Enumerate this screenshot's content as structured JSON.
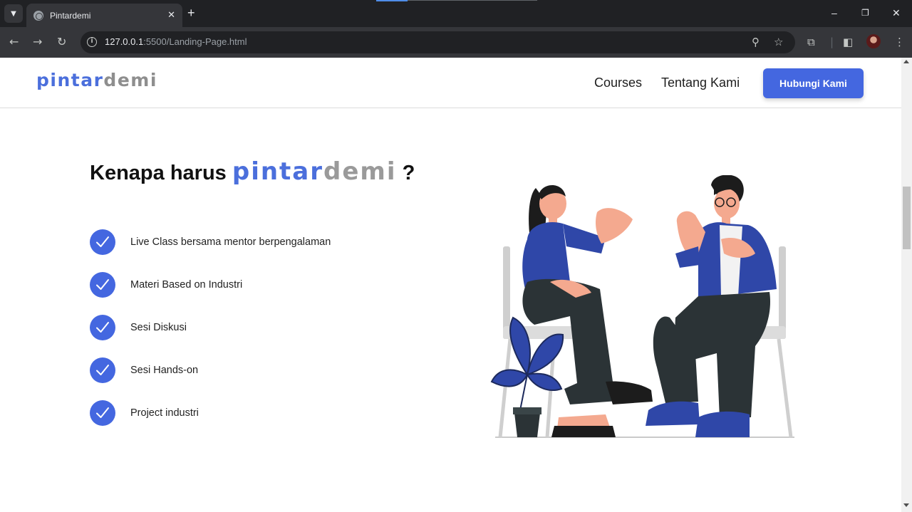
{
  "browser": {
    "tab_title": "Pintardemi",
    "url_host": "127.0.0.1",
    "url_rest": ":5500/Landing-Page.html"
  },
  "navbar": {
    "logo_part1": "pintar",
    "logo_part2": "demi",
    "links": [
      "Courses",
      "Tentang Kami"
    ],
    "cta_label": "Hubungi Kami"
  },
  "section": {
    "headline_prefix": "Kenapa harus",
    "brand_part1": "pintar",
    "brand_part2": "demi",
    "headline_suffix": "?",
    "features": [
      "Live Class bersama mentor berpengalaman",
      "Materi Based on Industri",
      "Sesi Diskusi",
      "Sesi Hands-on",
      "Project industri"
    ]
  },
  "colors": {
    "accent": "#4467e0",
    "logo_blue": "#4b6fdc",
    "logo_gray": "#8e8e8e",
    "figure_blue": "#2f47a8",
    "figure_dark": "#2b3336"
  }
}
